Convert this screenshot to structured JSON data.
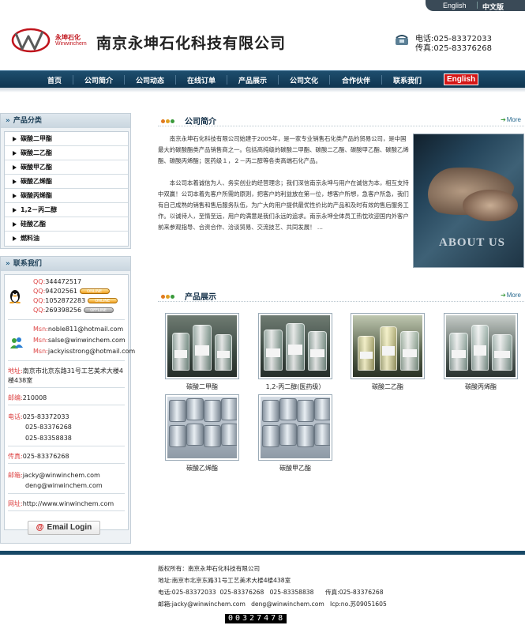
{
  "lang": {
    "english": "English",
    "chinese": "中文版"
  },
  "logo": {
    "cn": "永坤石化",
    "en": "Winwinchem"
  },
  "company_name": "南京永坤石化科技有限公司",
  "header_contact": {
    "phone": "电话:025-83372033",
    "fax": "传真:025-83376268"
  },
  "nav": [
    "首页",
    "公司简介",
    "公司动态",
    "在线订单",
    "产品展示",
    "公司文化",
    "合作伙伴",
    "联系我们"
  ],
  "nav_english": "English",
  "sidebar": {
    "categories_title": "产品分类",
    "categories": [
      "碳酸二甲酯",
      "碳酸二乙酯",
      "碳酸甲乙酯",
      "碳酸乙烯酯",
      "碳酸丙烯酯",
      "1,2－丙二醇",
      "硅酸乙酯",
      "燃料油"
    ],
    "contact_title": "联系我们",
    "qq_label": "QQ:",
    "qq": [
      {
        "number": "344472517",
        "status": ""
      },
      {
        "number": "94202561",
        "status": "ONLINE"
      },
      {
        "number": "1052872283",
        "status": "ONLINE"
      },
      {
        "number": "269398256",
        "status": "OFFLINE"
      }
    ],
    "msn_label": "Msn:",
    "msn": [
      "noble811@hotmail.com",
      "salse@winwinchem.com",
      "jackyisstrong@hotmail.com"
    ],
    "address_label": "地址:",
    "address_line1": "南京市北京东路31号工艺美术大楼4",
    "address_line2": "楼438室",
    "zip_label": "邮编:",
    "zip": "210008",
    "phone_label": "电话:",
    "phones": [
      "025-83372033",
      "025-83376268",
      "025-83358838"
    ],
    "fax_label": "传真:",
    "fax": "025-83376268",
    "email_label": "邮箱:",
    "emails": [
      "jacky@winwinchem.com",
      "deng@winwinchem.com"
    ],
    "web_label": "网址:",
    "web": "http://www.winwinchem.com",
    "email_login": "Email Login"
  },
  "about": {
    "title": "公司简介",
    "more": "More",
    "p1": "南京永坤石化科技有限公司始建于2005年，是一家专业销售石化类产品的贸易公司，是中国最大的碳酸酯类产品销售商之一。包括高纯级的碳酸二甲酯、碳酸二乙酯、碳酸甲乙酯、碳酸乙烯酯、碳酸丙烯酯；医药级１，２－丙二醇等各类高端石化产品。",
    "p2": "本公司本着诚信为人、务实创业的经营理念；我们深信南京永坤与用户在诚信为本，相互支持中双赢！公司本着先客户所需的原则，把客户的利益放在第一位，想客户所想，急客户所急，我们有自己成熟的销售和售后服务队伍，为广大的用户提供最优性价比的产品和及时有效的售后服务工作。以诚待人，至情至远，用户的满意是我们永远的追求。南京永坤全体员工热忱欢迎国内外客户前来参观指导、合资合作、洽谈贸易、交流技艺、共同发展！ ...",
    "image_text": "ABOUT US"
  },
  "products": {
    "title": "产品展示",
    "more": "More",
    "items": [
      "碳酸二甲酯",
      "1,2-丙二醇(医药级）",
      "碳酸二乙酯",
      "碳酸丙烯酯",
      "碳酸乙烯酯",
      "碳酸甲乙酯"
    ]
  },
  "footer": {
    "copyright": "版权所有：南京永坤石化科技有限公司",
    "address": "地址:南京市北京东路31号工艺美术大楼4楼438室",
    "phones": "电话:025-83372033  025-83376268   025-83358838      传真:025-83376268",
    "emails": "邮箱:jacky@winwinchem.com   deng@winwinchem.com   Icp:no.苏09051605",
    "counter": "00327478"
  },
  "colors": {
    "nav": "#174866",
    "accent_red": "#d41616",
    "label_red": "#dd4444",
    "dot_orange": "#e07a20",
    "dot_green": "#3a9a3a"
  }
}
